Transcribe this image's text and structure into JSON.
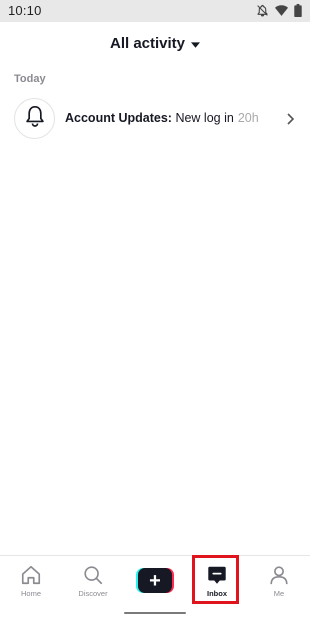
{
  "status_bar": {
    "time": "10:10",
    "icons": [
      "notifications-off-icon",
      "wifi-icon",
      "battery-icon"
    ]
  },
  "header": {
    "title": "All activity",
    "dropdown_icon": "caret-down-icon"
  },
  "section": {
    "label": "Today"
  },
  "notifications": [
    {
      "icon": "bell-icon",
      "title": "Account Updates:",
      "message": "New log in",
      "time": "20h"
    }
  ],
  "bottom_nav": {
    "home": "Home",
    "discover": "Discover",
    "inbox": "Inbox",
    "me": "Me",
    "create_symbol": "+",
    "active": "inbox"
  },
  "colors": {
    "text_primary": "#161823",
    "text_secondary": "#8a8b91",
    "accent_cyan": "#25f4ee",
    "accent_pink": "#fe2c55",
    "highlight": "#e0141c"
  }
}
